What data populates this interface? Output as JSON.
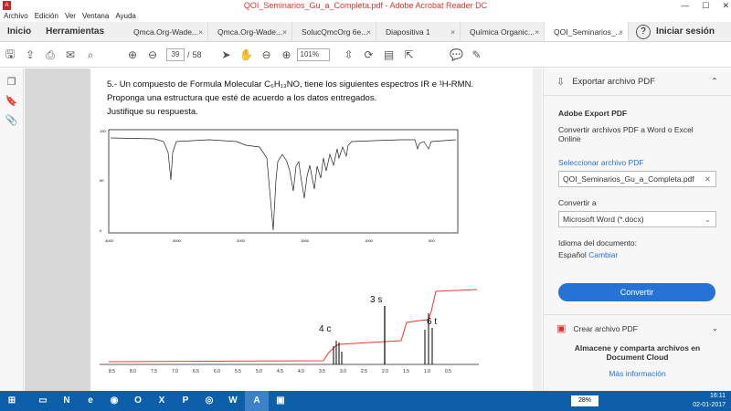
{
  "window": {
    "title": "QOI_Seminarios_Gu_a_Completa.pdf - Adobe Acrobat Reader DC"
  },
  "menu": [
    "Archivo",
    "Edición",
    "Ver",
    "Ventana",
    "Ayuda"
  ],
  "tabs": {
    "home": "Inicio",
    "tools": "Herramientas",
    "docs": [
      "Qmca.Org-Wade...",
      "Qmca.Org-Wade...",
      "SolucQmcOrg 6e...",
      "Diapositiva 1",
      "Química Organic...",
      "QOI_Seminarios_..."
    ],
    "help": "?",
    "signin": "Iniciar sesión"
  },
  "toolbar": {
    "page_current": "39",
    "page_sep": "/",
    "page_total": "58",
    "zoom": "101%"
  },
  "document": {
    "q_line1": "5.- Un compuesto de Formula Molecular C₆H₁₃NO, tiene los siguientes espectros IR e ¹H-RMN.",
    "q_line2": "Proponga una estructura que esté de acuerdo a los datos entregados.",
    "q_line3": "Justifique su respuesta.",
    "ir_yticks": [
      "100",
      "50",
      "0"
    ],
    "ir_xticks": [
      "4000",
      "3000",
      "2000",
      "1500",
      "1000",
      "500"
    ],
    "nmr_labels": [
      "4 c",
      "3 s",
      "6 t"
    ],
    "nmr_xticks": [
      "8.5",
      "8.0",
      "7.5",
      "7.0",
      "6.5",
      "6.0",
      "5.5",
      "5.0",
      "4.5",
      "4.0",
      "3.5",
      "3.0",
      "2.5",
      "2.0",
      "1.5",
      "1.0",
      "0.5"
    ]
  },
  "panel": {
    "header": "Exportar archivo PDF",
    "title": "Adobe Export PDF",
    "subtitle": "Convertir archivos PDF a Word o Excel Online",
    "select_link": "Seleccionar archivo PDF",
    "file_name": "QOI_Seminarios_Gu_a_Completa.pdf",
    "convert_to_label": "Convertir a",
    "format": "Microsoft Word (*.docx)",
    "lang_label": "Idioma del documento:",
    "lang_value": "Español",
    "lang_change": "Cambiar",
    "convert_button": "Convertir",
    "create_pdf": "Crear archivo PDF",
    "store_title": "Almacene y comparta archivos en Document Cloud",
    "more_info": "Más información"
  },
  "taskbar": {
    "battery": "28%",
    "time": "16:11",
    "date": "02-01-2017"
  },
  "colors": {
    "accent": "#2673d8",
    "taskbar": "#0c5fa8",
    "nmr_integral": "#e53935"
  }
}
